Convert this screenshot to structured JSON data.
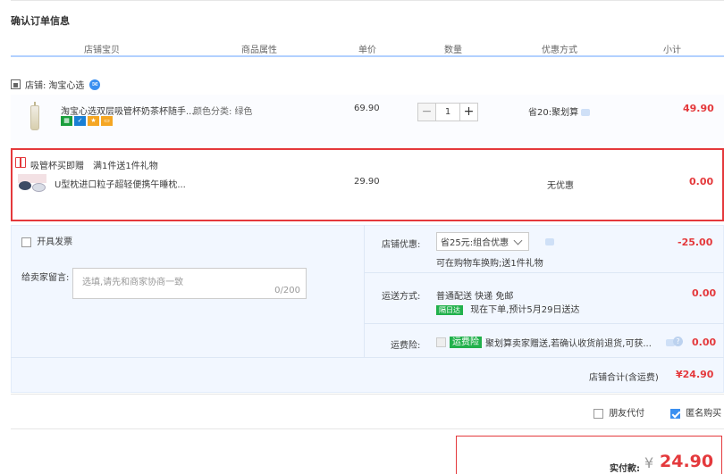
{
  "page": {
    "title": "确认订单信息"
  },
  "columns": [
    "店铺宝贝",
    "商品属性",
    "单价",
    "数量",
    "优惠方式",
    "小计"
  ],
  "shop": {
    "label": "店铺:",
    "name": "淘宝心选"
  },
  "item": {
    "name": "淘宝心选双层吸管杯奶茶杯随手...",
    "attr": "颜色分类: 绿色",
    "price": "69.90",
    "quantity": "1",
    "minus": "−",
    "plus": "+",
    "discount": "省20:聚划算",
    "subtotal": "49.90"
  },
  "gift": {
    "label": "吸管杯买即赠",
    "rule": "满1件送1件礼物",
    "name": "U型枕进口粒子超轻便携午睡枕...",
    "price": "29.90",
    "discount": "无优惠",
    "subtotal": "0.00"
  },
  "invoice": {
    "label": "开具发票"
  },
  "message": {
    "label": "给卖家留言:",
    "placeholder": "选填,请先和商家协商一致",
    "count": "0/200"
  },
  "shop_discount": {
    "label": "店铺优惠:",
    "selected": "省25元:组合优惠",
    "note": "可在购物车换购;送1件礼物",
    "amount": "-25.00"
  },
  "shipping": {
    "label": "运送方式:",
    "method": "普通配送 快递 免邮",
    "tag": "隔日达",
    "eta": "现在下单,预计5月29日送达",
    "amount": "0.00"
  },
  "insurance": {
    "label": "运费险:",
    "tag": "运费险",
    "text": "聚划算卖家赠送,若确认收货前退货,可获...",
    "amount": "0.00"
  },
  "shop_total": {
    "label": "店铺合计(含运费)",
    "amount": "¥24.90"
  },
  "options": {
    "friend_pay": "朋友代付",
    "anonymous": "匿名购买"
  },
  "payment": {
    "label": "实付款:",
    "currency": "¥",
    "amount": "24.90"
  },
  "colors": {
    "accent": "#e4393c",
    "blue": "#3a8ff0",
    "panel": "#f2f7ff"
  }
}
